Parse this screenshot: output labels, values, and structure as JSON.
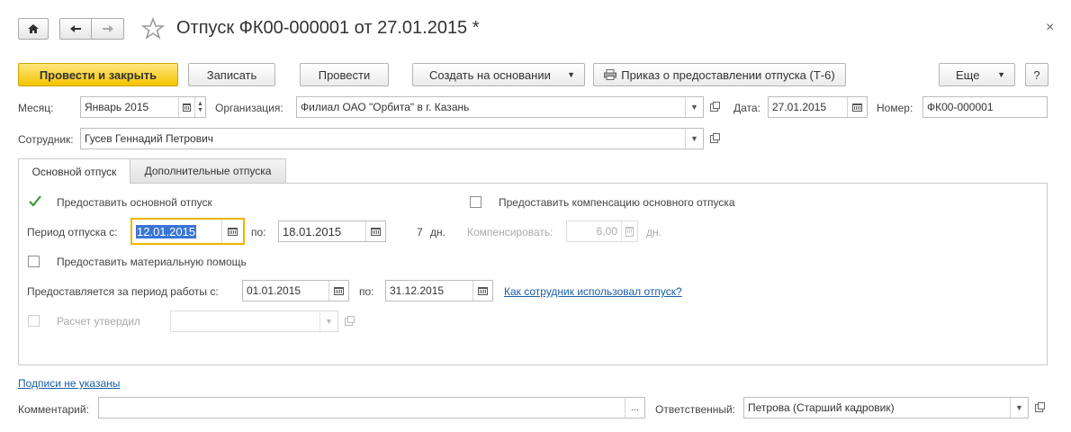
{
  "window": {
    "title": "Отпуск ФК00-000001 от 27.01.2015 *",
    "close_glyph": "×"
  },
  "toolbar": {
    "post_close": "Провести и закрыть",
    "write": "Записать",
    "post": "Провести",
    "create_based": "Создать на основании",
    "print_order": "Приказ о предоставлении отпуска (Т-6)",
    "more": "Еще",
    "help": "?"
  },
  "header": {
    "month_label": "Месяц:",
    "month_value": "Январь 2015",
    "org_label": "Организация:",
    "org_value": "Филиал ОАО \"Орбита\" в г. Казань",
    "date_label": "Дата:",
    "date_value": "27.01.2015",
    "number_label": "Номер:",
    "number_value": "ФК00-000001",
    "employee_label": "Сотрудник:",
    "employee_value": "Гусев Геннадий Петрович"
  },
  "tabs": [
    {
      "label": "Основной отпуск",
      "active": true
    },
    {
      "label": "Дополнительные отпуска",
      "active": false
    }
  ],
  "main_tab": {
    "grant_main_label": "Предоставить основной отпуск",
    "grant_main_checked": true,
    "grant_comp_label": "Предоставить компенсацию основного отпуска",
    "grant_comp_checked": false,
    "period_from_label": "Период отпуска с:",
    "period_from_value": "12.01.2015",
    "period_to_label": "по:",
    "period_to_value": "18.01.2015",
    "days_count": "7",
    "days_unit": "дн.",
    "compensate_label": "Компенсировать:",
    "compensate_value": "6,00",
    "compensate_unit": "дн.",
    "material_aid_label": "Предоставить материальную помощь",
    "material_aid_checked": false,
    "work_period_label": "Предоставляется за период работы с:",
    "work_from_value": "01.01.2015",
    "work_to_label": "по:",
    "work_to_value": "31.12.2015",
    "usage_link": "Как сотрудник использовал отпуск?",
    "approved_label": "Расчет утвердил",
    "approved_value": ""
  },
  "footer": {
    "signatures_link": "Подписи не указаны",
    "comment_label": "Комментарий:",
    "comment_value": "",
    "comment_button": "...",
    "responsible_label": "Ответственный:",
    "responsible_value": "Петрова (Старший кадровик)"
  },
  "colors": {
    "primary_button": "#f5c400",
    "link": "#1a5fa8",
    "selection": "#3875d7",
    "focus_border": "#f0b400",
    "checkmark": "#3a9a3a"
  }
}
